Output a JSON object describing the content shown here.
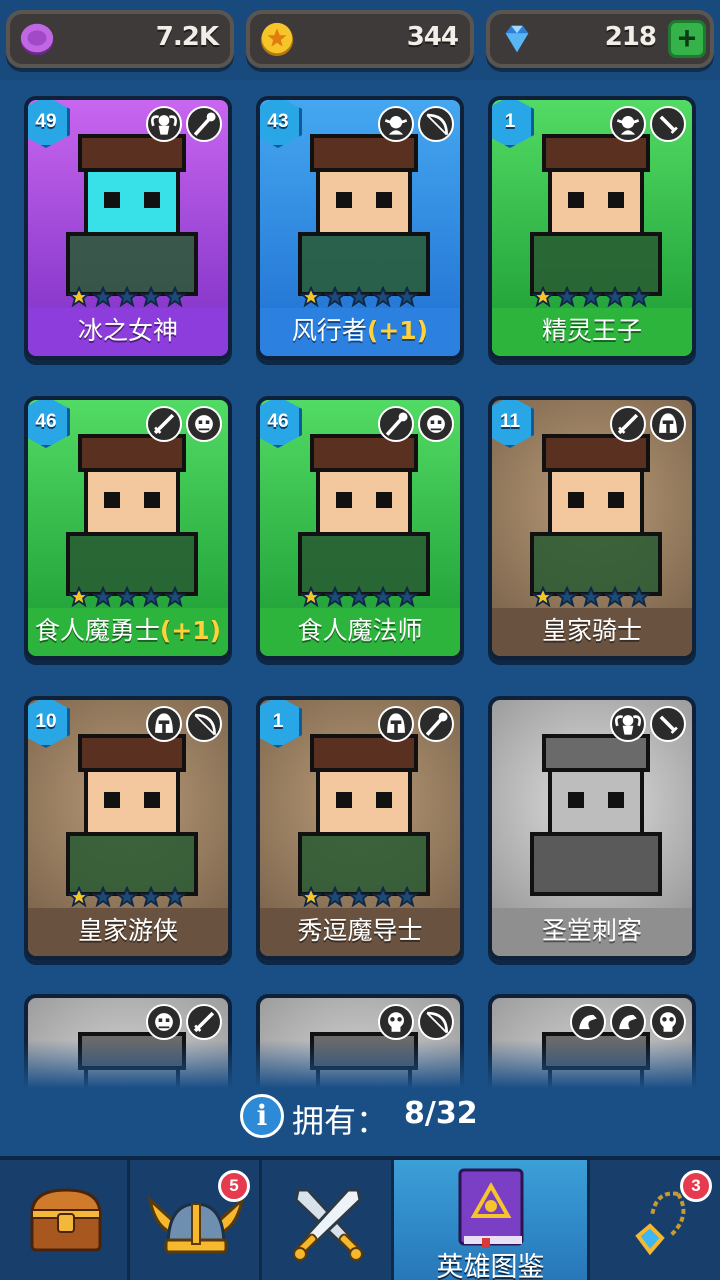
{
  "resources": {
    "elixir": {
      "value": "7.2K",
      "icon": "purple-coin-icon",
      "color": "#b05ad6"
    },
    "gold": {
      "value": "344",
      "icon": "gold-coin-icon",
      "color": "#f2c21a"
    },
    "gems": {
      "value": "218",
      "icon": "gem-icon",
      "color": "#3fa9f5"
    },
    "add_icon": "plus-icon"
  },
  "heroes": [
    {
      "name": "冰之女神",
      "bonus": "",
      "level": "49",
      "stars": 1,
      "theme": "purple",
      "owned": true,
      "badges": [
        "angel-icon",
        "staff-icon"
      ]
    },
    {
      "name": "风行者",
      "bonus": "(+1)",
      "level": "43",
      "stars": 1,
      "theme": "blue",
      "owned": true,
      "badges": [
        "elf-icon",
        "bow-icon"
      ]
    },
    {
      "name": "精灵王子",
      "bonus": "",
      "level": "1",
      "stars": 1,
      "theme": "green",
      "owned": true,
      "badges": [
        "elf-icon",
        "dagger-icon"
      ]
    },
    {
      "name": "食人魔勇士",
      "bonus": "(+1)",
      "level": "46",
      "stars": 1,
      "theme": "green",
      "owned": true,
      "badges": [
        "sword-icon",
        "ogre-icon"
      ]
    },
    {
      "name": "食人魔法师",
      "bonus": "",
      "level": "46",
      "stars": 1,
      "theme": "green",
      "owned": true,
      "badges": [
        "staff-icon",
        "ogre-icon"
      ]
    },
    {
      "name": "皇家骑士",
      "bonus": "",
      "level": "11",
      "stars": 1,
      "theme": "brown",
      "owned": true,
      "badges": [
        "sword-icon",
        "helmet-icon"
      ]
    },
    {
      "name": "皇家游侠",
      "bonus": "",
      "level": "10",
      "stars": 1,
      "theme": "brown",
      "owned": true,
      "badges": [
        "helmet-icon",
        "bow-icon"
      ]
    },
    {
      "name": "秀逗魔导士",
      "bonus": "",
      "level": "1",
      "stars": 1,
      "theme": "brown",
      "owned": true,
      "badges": [
        "helmet-icon",
        "staff-icon"
      ]
    },
    {
      "name": "圣堂刺客",
      "bonus": "",
      "level": "",
      "stars": 0,
      "theme": "gray",
      "owned": false,
      "badges": [
        "angel-icon",
        "dagger-icon"
      ]
    },
    {
      "name": "",
      "bonus": "",
      "level": "",
      "stars": 0,
      "theme": "gray",
      "owned": false,
      "badges": [
        "ogre-icon",
        "sword-icon"
      ]
    },
    {
      "name": "",
      "bonus": "",
      "level": "",
      "stars": 0,
      "theme": "gray",
      "owned": false,
      "badges": [
        "skull-icon",
        "bow-icon"
      ]
    },
    {
      "name": "",
      "bonus": "",
      "level": "",
      "stars": 0,
      "theme": "gray",
      "owned": false,
      "badges": [
        "dragon-icon",
        "dragon-icon",
        "skull-icon"
      ]
    }
  ],
  "owned": {
    "label": "拥有：",
    "count": "8/32",
    "icon": "info-icon"
  },
  "nav": {
    "tabs": [
      {
        "icon": "chest-icon",
        "label": "",
        "badge": ""
      },
      {
        "icon": "viking-helmet-icon",
        "label": "",
        "badge": "5"
      },
      {
        "icon": "crossed-swords-icon",
        "label": "",
        "badge": ""
      },
      {
        "icon": "hero-book-icon",
        "label": "英雄图鉴",
        "badge": "",
        "active": true
      },
      {
        "icon": "amulet-icon",
        "label": "",
        "badge": "3"
      }
    ]
  }
}
